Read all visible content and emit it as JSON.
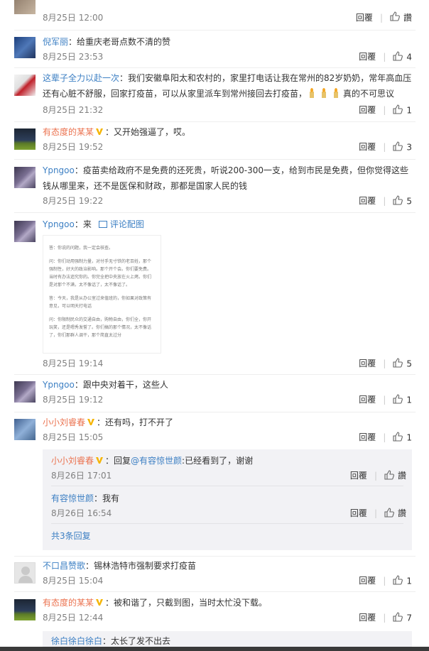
{
  "comments": [
    {
      "user": "",
      "text": "",
      "time": "8月25日 12:00",
      "reply_label": "回覆",
      "like_label": "讚"
    },
    {
      "user": "倪军丽",
      "text": "：给重庆老哥点数不清的赞",
      "time": "8月25日 23:53",
      "reply_label": "回覆",
      "like_count": "4"
    },
    {
      "user": "这辈子全力以赴一次",
      "text": "：我们安徽阜阳太和农村的，家里打电话让我在常州的82岁奶奶，常年高血压还有心脏不舒服，回家打疫苗，可以从家里派车到常州接回去打疫苗，",
      "text2": "真的不可思议",
      "time": "8月25日 21:32",
      "reply_label": "回覆",
      "like_count": "1"
    },
    {
      "user": "有态度的某某",
      "text": "：又开始强逼了，哎。",
      "time": "8月25日 19:52",
      "reply_label": "回覆",
      "like_count": "3"
    },
    {
      "user": "Ypngoo",
      "text": "：疫苗卖给政府不是免费的还死贵，听说200-300一支，给到市民是免费，但你觉得这些钱从哪里来，还不是医保和财政，那都是国家人民的钱",
      "time": "8月25日 19:22",
      "reply_label": "回覆",
      "like_count": "5"
    },
    {
      "user": "Ypngoo",
      "text": "：来",
      "pic_label": "评论配图",
      "time": "8月25日 19:14",
      "reply_label": "回覆",
      "like_count": "5"
    },
    {
      "user": "Ypngoo",
      "text": "：跟中央对着干，这些人",
      "time": "8月25日 19:12",
      "reply_label": "回覆",
      "like_count": "1"
    },
    {
      "user": "小小刘睿春",
      "text": "：还有吗，打不开了",
      "time": "8月25日 15:05",
      "reply_label": "回覆",
      "like_count": "1"
    },
    {
      "user": "不口昌赞歌",
      "text": "：锡林浩特市强制要求打疫苗",
      "time": "8月25日 15:04",
      "reply_label": "回覆",
      "like_count": "1"
    },
    {
      "user": "有态度的某某",
      "text": "：被和谐了，只截到图，当时太忙没下载。",
      "time": "8月25日 12:44",
      "reply_label": "回覆",
      "like_count": "7"
    },
    {
      "user": "徐白徐白徐白",
      "text": "：太长了发不出去"
    }
  ],
  "replies": [
    {
      "user": "小小刘睿春",
      "text_pre": "：回复",
      "mention": "@有容惊世颜",
      "text_post": ":已经看到了，谢谢",
      "time": "8月26日 17:01",
      "reply_label": "回覆",
      "like_label": "讚"
    },
    {
      "user": "有容惊世颜",
      "text": "：我有",
      "time": "8月26日 16:54",
      "reply_label": "回覆",
      "like_label": "讚"
    }
  ],
  "more_replies": "共3条回复",
  "image_text": [
    "答：你说的问题，我一定会核查。",
    "问：你们动用强制力量，对付手无寸铁的老百姓，那个强制性，好大的政治影响。那个开个会。你们要免费。当时有办法追究你的。你完全把中央放在火上烤。你们是对那个不满，太不像话了，太不像话了。",
    "答：今天，我是从办公室过来值班的，你如果对政策有意见，可以明天打电话",
    "问：你限制民众的交通自由，购物自由，你们全，你开玩笑，还是嗯秀发誓了。你们搞的那个情况，太不像话了，你们那群人调干，那个简直太过分"
  ],
  "colors": {
    "link": "#3c7fc3",
    "orange": "#eb7350",
    "time": "#808080",
    "reply_bg": "#f2f2f5"
  }
}
